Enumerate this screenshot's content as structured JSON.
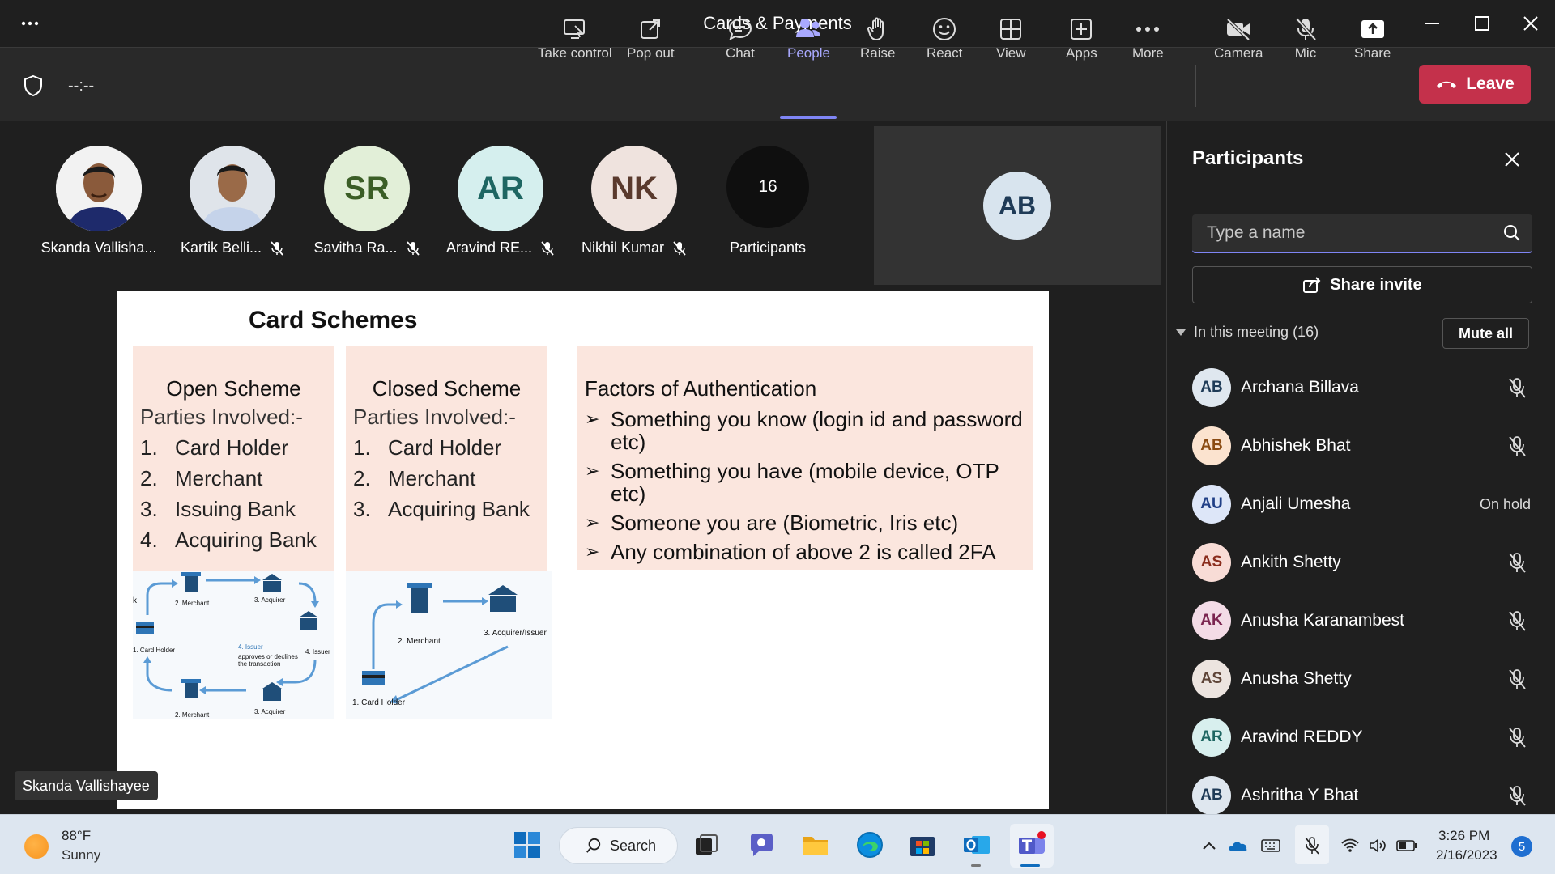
{
  "window": {
    "title": "Cards & Payments"
  },
  "toolbar": {
    "timer": "--:--",
    "items": [
      {
        "label": "Take control",
        "icon": "take-control-icon"
      },
      {
        "label": "Pop out",
        "icon": "pop-out-icon"
      },
      {
        "label": "Chat",
        "icon": "chat-icon"
      },
      {
        "label": "People",
        "icon": "people-icon",
        "active": true
      },
      {
        "label": "Raise",
        "icon": "raise-hand-icon"
      },
      {
        "label": "React",
        "icon": "react-icon"
      },
      {
        "label": "View",
        "icon": "view-icon"
      },
      {
        "label": "Apps",
        "icon": "apps-icon"
      },
      {
        "label": "More",
        "icon": "more-icon"
      },
      {
        "label": "Camera",
        "icon": "camera-off-icon"
      },
      {
        "label": "Mic",
        "icon": "mic-off-icon"
      },
      {
        "label": "Share",
        "icon": "share-icon"
      }
    ],
    "leave_label": "Leave",
    "accent_color": "#7f85f5",
    "leave_color": "#c4314b"
  },
  "gallery": {
    "people": [
      {
        "name": "Skanda Vallisha...",
        "initials": "",
        "muted": false
      },
      {
        "name": "Kartik Belli...",
        "initials": "",
        "muted": true
      },
      {
        "name": "Savitha Ra...",
        "initials": "SR",
        "muted": true
      },
      {
        "name": "Aravind RE...",
        "initials": "AR",
        "muted": true
      },
      {
        "name": "Nikhil Kumar",
        "initials": "NK",
        "muted": true
      }
    ],
    "overflow_count": "16",
    "overflow_label": "Participants",
    "self_initials": "AB"
  },
  "slide": {
    "title": "Card Schemes",
    "open_scheme": {
      "heading": "Open Scheme",
      "sub": "Parties Involved:-",
      "items": [
        {
          "num": "1.",
          "text": "Card Holder"
        },
        {
          "num": "2.",
          "text": "Merchant"
        },
        {
          "num": "3.",
          "text": "Issuing Bank"
        },
        {
          "num": "4.",
          "text": "Acquiring Bank"
        }
      ],
      "diagram_labels": [
        "2. Merchant",
        "3. Acquirer",
        "1. Card Holder",
        "4. Issuer",
        "approves or declines",
        "the transaction",
        "4. Issuer",
        "2. Merchant",
        "3. Acquirer",
        "k"
      ]
    },
    "closed_scheme": {
      "heading": "Closed Scheme",
      "sub": "Parties Involved:-",
      "items": [
        {
          "num": "1.",
          "text": "Card Holder"
        },
        {
          "num": "2.",
          "text": "Merchant"
        },
        {
          "num": "3.",
          "text": "Acquiring Bank"
        }
      ],
      "diagram_labels": [
        "2. Merchant",
        "3. Acquirer/Issuer",
        "1. Card Holder"
      ]
    },
    "factors": {
      "heading": "Factors of Authentication",
      "items": [
        "Something you know (login id and password etc)",
        "Something you have (mobile device, OTP etc)",
        "Someone you are (Biometric, Iris etc)",
        "Any combination of above 2 is called 2FA"
      ]
    },
    "speaker_tag": "Skanda Vallishayee"
  },
  "panel": {
    "title": "Participants",
    "search_placeholder": "Type a name",
    "share_invite": "Share invite",
    "section_label": "In this meeting (16)",
    "mute_all": "Mute all",
    "participants": [
      {
        "initials": "AB",
        "name": "Archana Billava",
        "status": "",
        "bg": "#dfe7ef",
        "fg": "#1f3b57"
      },
      {
        "initials": "AB",
        "name": "Abhishek Bhat",
        "status": "",
        "bg": "#fbe3cf",
        "fg": "#8a4b12"
      },
      {
        "initials": "AU",
        "name": "Anjali Umesha",
        "status": "On hold",
        "bg": "#dde6f8",
        "fg": "#203f86"
      },
      {
        "initials": "AS",
        "name": "Ankith Shetty",
        "status": "",
        "bg": "#f8dcd6",
        "fg": "#8a2d1d"
      },
      {
        "initials": "AK",
        "name": "Anusha Karanambest",
        "status": "",
        "bg": "#f3dbe6",
        "fg": "#7b2450"
      },
      {
        "initials": "AS",
        "name": "Anusha Shetty",
        "status": "",
        "bg": "#ece4df",
        "fg": "#5e4437"
      },
      {
        "initials": "AR",
        "name": "Aravind REDDY",
        "status": "",
        "bg": "#d8efee",
        "fg": "#1e6662"
      },
      {
        "initials": "AB",
        "name": "Ashritha Y Bhat",
        "status": "",
        "bg": "#dfe7ef",
        "fg": "#1f3b57"
      }
    ]
  },
  "taskbar": {
    "weather_temp": "88°F",
    "weather_cond": "Sunny",
    "search_label": "Search",
    "time": "3:26 PM",
    "date": "2/16/2023",
    "notifications": "5"
  }
}
